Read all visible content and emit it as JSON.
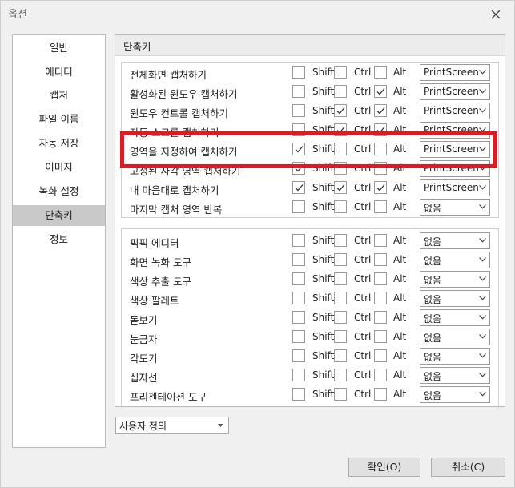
{
  "window": {
    "title": "옵션"
  },
  "sidebar": {
    "items": [
      {
        "label": "일반"
      },
      {
        "label": "에디터"
      },
      {
        "label": "캡처"
      },
      {
        "label": "파일 이름"
      },
      {
        "label": "자동 저장"
      },
      {
        "label": "이미지"
      },
      {
        "label": "녹화 설정"
      },
      {
        "label": "단축키",
        "selected": true
      },
      {
        "label": "정보"
      }
    ]
  },
  "section": {
    "title": "단축키"
  },
  "modifiers": {
    "shift": "Shift",
    "ctrl": "Ctrl",
    "alt": "Alt"
  },
  "group1": [
    {
      "label": "전체화면 캡처하기",
      "shift": false,
      "ctrl": false,
      "alt": false,
      "key": "PrintScreen"
    },
    {
      "label": "활성화된 윈도우 캡처하기",
      "shift": false,
      "ctrl": false,
      "alt": true,
      "key": "PrintScreen"
    },
    {
      "label": "윈도우 컨트롤 캡처하기",
      "shift": false,
      "ctrl": true,
      "alt": true,
      "key": "PrintScreen"
    },
    {
      "label": "자동 스크롤 캡처하기",
      "shift": false,
      "ctrl": true,
      "alt": true,
      "key": "PrintScreen"
    },
    {
      "label": "영역을 지정하여 캡처하기",
      "shift": true,
      "ctrl": false,
      "alt": false,
      "key": "PrintScreen"
    },
    {
      "label": "고정된 사각 영역 캡처하기",
      "shift": true,
      "ctrl": false,
      "alt": false,
      "key": "PrintScreen"
    },
    {
      "label": "내 마음대로 캡처하기",
      "shift": true,
      "ctrl": true,
      "alt": true,
      "key": "PrintScreen"
    },
    {
      "label": "마지막 캡처 영역 반복",
      "shift": false,
      "ctrl": false,
      "alt": false,
      "key": "없음"
    }
  ],
  "group2": [
    {
      "label": "픽픽 에디터",
      "shift": false,
      "ctrl": false,
      "alt": false,
      "key": "없음"
    },
    {
      "label": "화면 녹화 도구",
      "shift": false,
      "ctrl": false,
      "alt": false,
      "key": "없음"
    },
    {
      "label": "색상 추출 도구",
      "shift": false,
      "ctrl": false,
      "alt": false,
      "key": "없음"
    },
    {
      "label": "색상 팔레트",
      "shift": false,
      "ctrl": false,
      "alt": false,
      "key": "없음"
    },
    {
      "label": "돋보기",
      "shift": false,
      "ctrl": false,
      "alt": false,
      "key": "없음"
    },
    {
      "label": "눈금자",
      "shift": false,
      "ctrl": false,
      "alt": false,
      "key": "없음"
    },
    {
      "label": "각도기",
      "shift": false,
      "ctrl": false,
      "alt": false,
      "key": "없음"
    },
    {
      "label": "십자선",
      "shift": false,
      "ctrl": false,
      "alt": false,
      "key": "없음"
    },
    {
      "label": "프리젠테이션 도구",
      "shift": false,
      "ctrl": false,
      "alt": false,
      "key": "없음"
    }
  ],
  "preset": {
    "value": "사용자 정의"
  },
  "buttons": {
    "ok": "확인(O)",
    "cancel": "취소(C)"
  },
  "colors": {
    "highlight": "#e01a22",
    "selected_item": "#c9c9c9"
  },
  "icons": {
    "close": "close-icon",
    "check": "checkmark-icon",
    "dropdown": "chevron-down-icon"
  }
}
